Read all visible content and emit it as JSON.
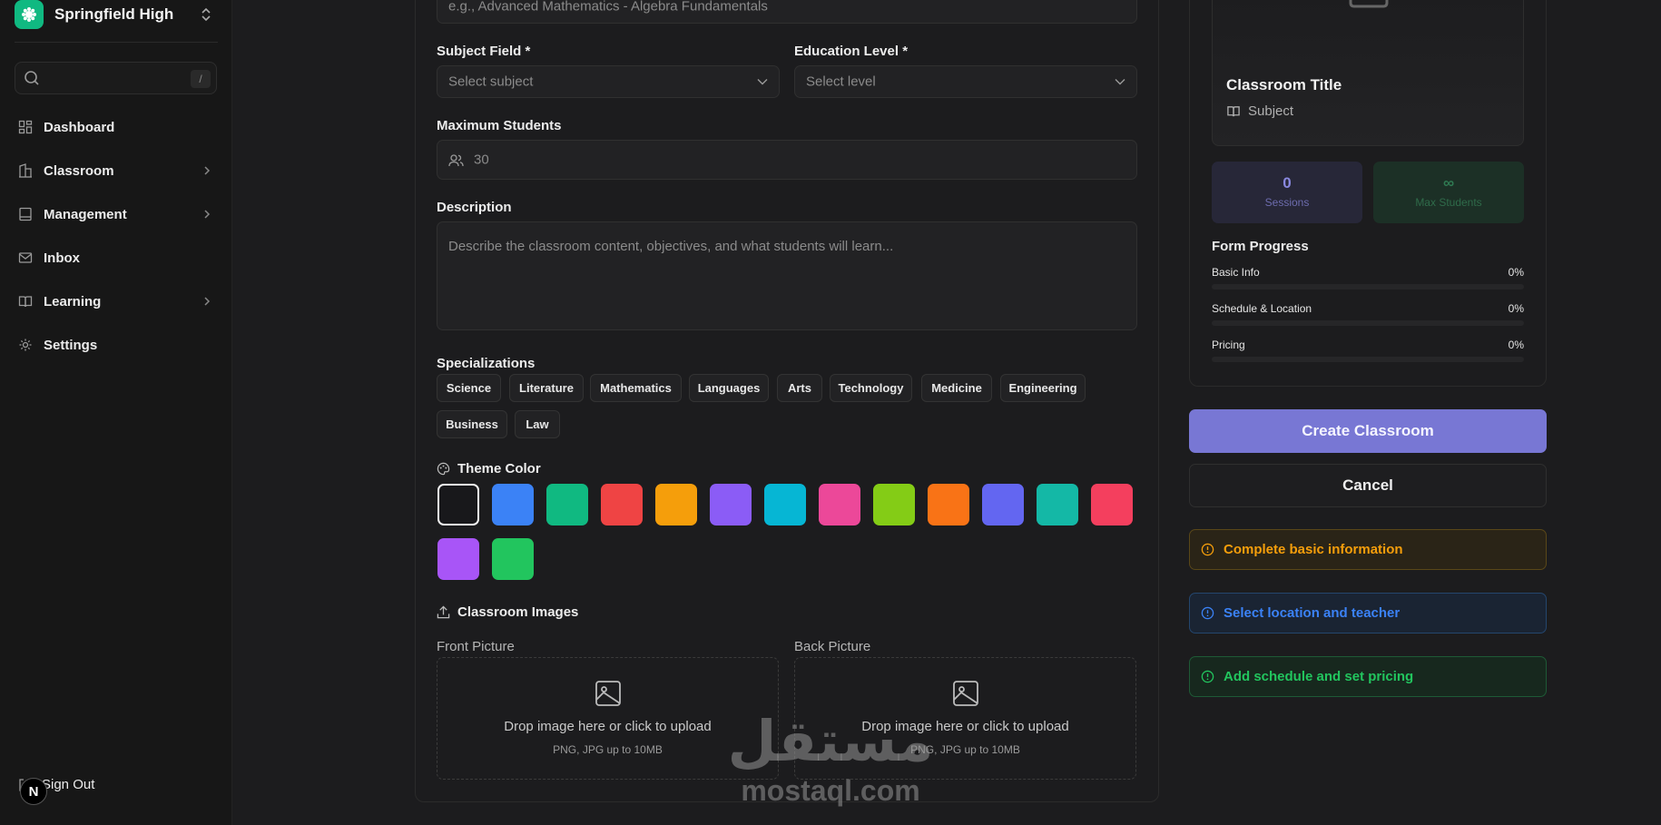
{
  "sidebar": {
    "org_name": "Springfield High",
    "search": {
      "placeholder": "",
      "shortcut": "/"
    },
    "items": [
      {
        "label": "Dashboard",
        "icon": "dashboard-icon",
        "has_submenu": false
      },
      {
        "label": "Classroom",
        "icon": "classroom-icon",
        "has_submenu": true
      },
      {
        "label": "Management",
        "icon": "management-icon",
        "has_submenu": true
      },
      {
        "label": "Inbox",
        "icon": "mail-icon",
        "has_submenu": false
      },
      {
        "label": "Learning",
        "icon": "book-icon",
        "has_submenu": true
      },
      {
        "label": "Settings",
        "icon": "gear-icon",
        "has_submenu": false
      }
    ],
    "sign_out": "Sign Out",
    "badge_letter": "N"
  },
  "form": {
    "title_placeholder": "e.g., Advanced Mathematics - Algebra Fundamentals",
    "subject_label": "Subject Field *",
    "subject_placeholder": "Select subject",
    "level_label": "Education Level *",
    "level_placeholder": "Select level",
    "max_students_label": "Maximum Students",
    "max_students_placeholder": "30",
    "description_label": "Description",
    "description_placeholder": "Describe the classroom content, objectives, and what students will learn...",
    "specializations_label": "Specializations",
    "specializations": [
      "Science",
      "Literature",
      "Mathematics",
      "Languages",
      "Arts",
      "Technology",
      "Medicine",
      "Engineering",
      "Business",
      "Law"
    ],
    "theme_label": "Theme Color",
    "theme_colors": [
      "#18181b",
      "#3b82f6",
      "#10b981",
      "#ef4444",
      "#f59e0b",
      "#8b5cf6",
      "#06b6d4",
      "#ec4899",
      "#84cc16",
      "#f97316",
      "#6366f1",
      "#14b8a6",
      "#f43f5e",
      "#a855f7",
      "#22c55e"
    ],
    "selected_color": "#18181b",
    "images_label": "Classroom Images",
    "front_label": "Front Picture",
    "back_label": "Back Picture",
    "drop_text": "Drop image here or click to upload",
    "drop_sub": "PNG, JPG up to 10MB"
  },
  "preview": {
    "title": "Classroom Title",
    "subject": "Subject",
    "sessions_value": "0",
    "sessions_label": "Sessions",
    "max_value": "∞",
    "max_label": "Max Students",
    "progress_title": "Form Progress",
    "progress": [
      {
        "label": "Basic Info",
        "pct_text": "0%",
        "value": 0
      },
      {
        "label": "Schedule & Location",
        "pct_text": "0%",
        "value": 0
      },
      {
        "label": "Pricing",
        "pct_text": "0%",
        "value": 0
      }
    ]
  },
  "actions": {
    "create": "Create Classroom",
    "cancel": "Cancel"
  },
  "alerts": [
    {
      "text": "Complete basic information",
      "color": "#f59e0b"
    },
    {
      "text": "Select location and teacher",
      "color": "#3b82f6"
    },
    {
      "text": "Add schedule and set pricing",
      "color": "#22c55e"
    }
  ],
  "watermark": {
    "arabic": "مستقل",
    "latin": "mostaql.com"
  }
}
